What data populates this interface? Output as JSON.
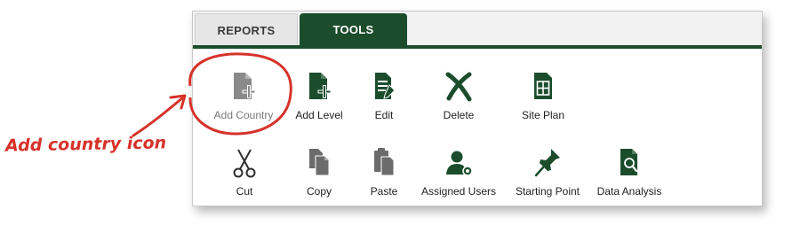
{
  "tabs": [
    {
      "label": "REPORTS",
      "active": false
    },
    {
      "label": "TOOLS",
      "active": true
    }
  ],
  "tools_row1": [
    {
      "label": "Add Country",
      "icon": "add-country-icon",
      "disabled": true
    },
    {
      "label": "Add Level",
      "icon": "add-level-icon"
    },
    {
      "label": "Edit",
      "icon": "edit-icon"
    },
    {
      "label": "Delete",
      "icon": "delete-icon"
    },
    {
      "label": "Site Plan",
      "icon": "site-plan-icon"
    }
  ],
  "tools_row2": [
    {
      "label": "Cut",
      "icon": "cut-icon"
    },
    {
      "label": "Copy",
      "icon": "copy-icon"
    },
    {
      "label": "Paste",
      "icon": "paste-icon"
    },
    {
      "label": "Assigned Users",
      "icon": "assigned-users-icon"
    },
    {
      "label": "Starting Point",
      "icon": "starting-point-icon"
    },
    {
      "label": "Data Analysis",
      "icon": "data-analysis-icon"
    }
  ],
  "annotation": {
    "text": "Add country icon"
  },
  "colors": {
    "accent": "#1b4d2c",
    "annotation": "#d6322a",
    "disabled_icon": "#8a8a8a"
  }
}
